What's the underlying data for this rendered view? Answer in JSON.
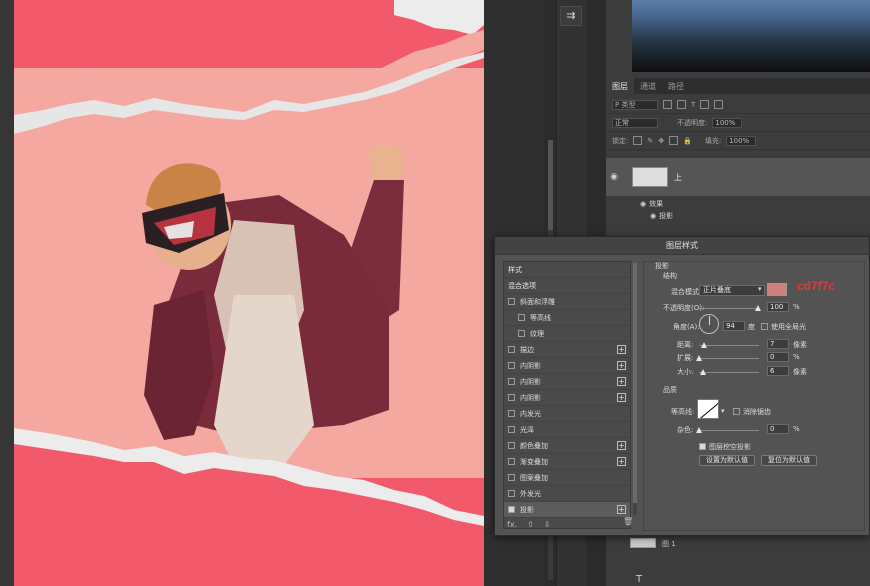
{
  "panel": {
    "tabs": [
      "图层",
      "通道",
      "路径"
    ],
    "filter_placeholder": "P 类型",
    "blend_mode": "正常",
    "opacity_label": "不透明度:",
    "opacity_value": "100%",
    "lock_label": "锁定:",
    "fill_label": "填充:",
    "fill_value": "100%",
    "layer_name": "上",
    "effects_label": "效果",
    "effect_item": "投影",
    "bottom_layer": "图 1",
    "tool_glyph": "T"
  },
  "dialog": {
    "title": "图层样式",
    "left_items": [
      {
        "label": "样式",
        "type": "header"
      },
      {
        "label": "混合选项",
        "type": "header"
      },
      {
        "label": "斜面和浮雕",
        "type": "check",
        "checked": false
      },
      {
        "label": "等高线",
        "type": "subcheck",
        "checked": false
      },
      {
        "label": "纹理",
        "type": "subcheck",
        "checked": false
      },
      {
        "label": "描边",
        "type": "check",
        "checked": false,
        "plus": true
      },
      {
        "label": "内阴影",
        "type": "check",
        "checked": false,
        "plus": true
      },
      {
        "label": "内阴影",
        "type": "check",
        "checked": false,
        "plus": true
      },
      {
        "label": "内阴影",
        "type": "check",
        "checked": false,
        "plus": true
      },
      {
        "label": "内发光",
        "type": "check",
        "checked": false
      },
      {
        "label": "光泽",
        "type": "check",
        "checked": false
      },
      {
        "label": "颜色叠加",
        "type": "check",
        "checked": false,
        "plus": true
      },
      {
        "label": "渐变叠加",
        "type": "check",
        "checked": false,
        "plus": true
      },
      {
        "label": "图案叠加",
        "type": "check",
        "checked": false
      },
      {
        "label": "外发光",
        "type": "check",
        "checked": false
      },
      {
        "label": "投影",
        "type": "check",
        "checked": true,
        "plus": true,
        "active": true
      }
    ],
    "footer_fx": "fx.",
    "section_title": "投影",
    "structure_label": "结构",
    "blend_label": "混合模式:",
    "blend_value": "正片叠底",
    "color_hex": "#cd7f7c",
    "color_annotation": "cd7f7c",
    "opacity_label": "不透明度(O):",
    "opacity_value": "100",
    "percent": "%",
    "angle_label": "角度(A):",
    "angle_value": "94",
    "degree_label": "度",
    "global_light_label": "使用全局光",
    "distance_label": "距离:",
    "distance_value": "7",
    "spread_label": "扩展:",
    "spread_value": "0",
    "size_label": "大小:",
    "size_value": "6",
    "px": "像素",
    "quality_label": "品质",
    "contour_label": "等高线:",
    "antialias_label": "消除锯齿",
    "noise_label": "杂色:",
    "noise_value": "0",
    "knockout_label": "图层挖空投影",
    "btn_default": "设置为默认值",
    "btn_reset": "复位为默认值"
  }
}
